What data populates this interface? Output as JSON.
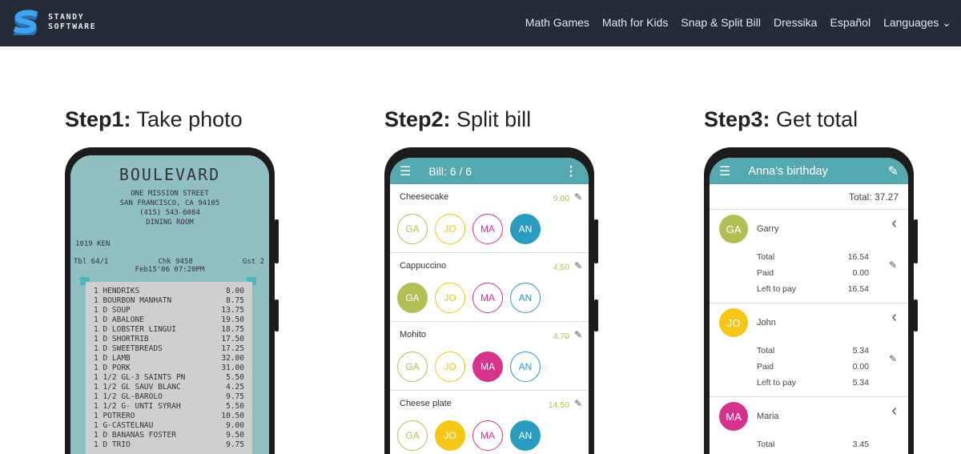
{
  "nav": {
    "logo_text_1": "STANDY",
    "logo_text_2": "SOFTWARE",
    "items": [
      "Math Games",
      "Math for Kids",
      "Snap & Split Bill",
      "Dressika",
      "Español",
      "Languages"
    ]
  },
  "steps": [
    {
      "label": "Step1:",
      "text": "Take photo"
    },
    {
      "label": "Step2:",
      "text": "Split bill"
    },
    {
      "label": "Step3:",
      "text": "Get total"
    }
  ],
  "colors": {
    "GA": "#b2bf55",
    "JO": "#f5c518",
    "MA": "#d6338c",
    "AN": "#2a9cc0",
    "accent": "#55a9ae"
  },
  "receipt": {
    "title": "BOULEVARD",
    "address": [
      "ONE MISSION STREET",
      "SAN FRANCISCO, CA 94105",
      "(415) 543-6084",
      "DINING ROOM"
    ],
    "server": "1019 KEN",
    "tbl": "Tbl 64/1",
    "chk": "Chk 9458",
    "gst": "Gst 2",
    "date": "Feb15'06 07:20PM",
    "items": [
      [
        "1 HENDRIKS",
        "8.00"
      ],
      [
        "1 BOURBON MANHATN",
        "8.75"
      ],
      [
        "1 D SOUP",
        "13.75"
      ],
      [
        "1 D ABALONE",
        "19.50"
      ],
      [
        "1 D LOBSTER LINGUI",
        "18.75"
      ],
      [
        "1 D SHORTRIB",
        "17.50"
      ],
      [
        "1 D SWEETBREADS",
        "17.25"
      ],
      [
        "1 D LAMB",
        "32.00"
      ],
      [
        "1 D PORK",
        "31.00"
      ],
      [
        "1 1/2 GL-3 SAINTS PN",
        "5.50"
      ],
      [
        "1 1/2 GL SAUV BLANC",
        "4.25"
      ],
      [
        "1 1/2 GL-BAROLO",
        "9.75"
      ],
      [
        "1 1/2 G- UNTI SYRAH",
        "5.50"
      ],
      [
        "1 POTRERO",
        "10.50"
      ],
      [
        "1 G-CASTELNAU",
        "9.00"
      ],
      [
        "1 D BANANAS FOSTER",
        "9.50"
      ],
      [
        "1 D TRIO",
        "9.75"
      ]
    ]
  },
  "split": {
    "title": "Bill: 6 / 6",
    "people": [
      "GA",
      "JO",
      "MA",
      "AN"
    ],
    "items": [
      {
        "name": "Cheesecake",
        "price": "9.00",
        "selected": [
          "AN"
        ]
      },
      {
        "name": "Cappuccino",
        "price": "4.50",
        "selected": [
          "GA"
        ]
      },
      {
        "name": "Mohito",
        "price": "4.70",
        "selected": [
          "MA"
        ]
      },
      {
        "name": "Cheese plate",
        "price": "14.50",
        "selected": [
          "JO",
          "AN"
        ]
      }
    ]
  },
  "totals": {
    "title": "Anna's birthday",
    "total": "Total: 37.27",
    "labels": [
      "Total",
      "Paid",
      "Left to pay"
    ],
    "people": [
      {
        "initials": "GA",
        "name": "Garry",
        "total": "16.54",
        "paid": "0.00",
        "left": "16.54"
      },
      {
        "initials": "JO",
        "name": "John",
        "total": "5.34",
        "paid": "0.00",
        "left": "5.34"
      },
      {
        "initials": "MA",
        "name": "Maria",
        "total": "3.45"
      }
    ]
  }
}
